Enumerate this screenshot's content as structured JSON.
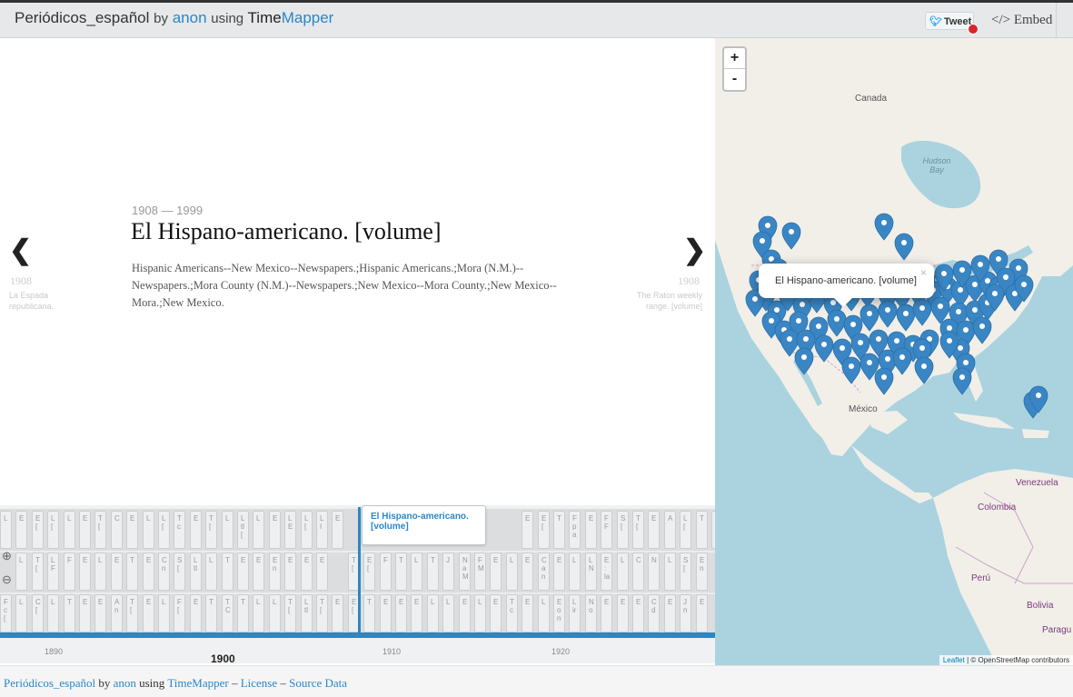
{
  "header": {
    "dataset_title": "Periódicos_español",
    "by_text": "by",
    "author": "anon",
    "using_text": "using",
    "app_name_part1": "Time",
    "app_name_part2": "Mapper",
    "tweet_label": "Tweet",
    "embed_label": "</> Embed"
  },
  "story": {
    "prev_arrow": "❮",
    "next_arrow": "❯",
    "prev": {
      "date": "1908",
      "title": "La Espada republicana."
    },
    "next": {
      "date": "1908",
      "title": "The Raton weekly range. [volume]"
    },
    "current": {
      "date_range": "1908 — 1999",
      "title": "El Hispano-americano. [volume]",
      "description": "Hispanic Americans--New Mexico--Newspapers.;Hispanic Americans.;Mora (N.M.)--Newspapers.;Mora County (N.M.)--Newspapers.;New Mexico--Mora County.;New Mexico--Mora.;New Mexico."
    }
  },
  "timeline": {
    "zoom_in_icon": "⊕",
    "zoom_out_icon": "⊖",
    "active_flag": "El Hispano-americano. [volume]",
    "ticks": [
      {
        "label": "1890",
        "major": false
      },
      {
        "label": "1900",
        "major": true
      },
      {
        "label": "1910",
        "major": false
      },
      {
        "label": "1920",
        "major": false
      }
    ],
    "markers": [
      {
        "r": 0,
        "i": 0,
        "t": "L"
      },
      {
        "r": 0,
        "i": 1,
        "t": "E"
      },
      {
        "r": 0,
        "i": 2,
        "t": "E ["
      },
      {
        "r": 0,
        "i": 3,
        "t": "L ["
      },
      {
        "r": 0,
        "i": 4,
        "t": "L"
      },
      {
        "r": 0,
        "i": 5,
        "t": "E"
      },
      {
        "r": 0,
        "i": 6,
        "t": "T ["
      },
      {
        "r": 0,
        "i": 7,
        "t": "C"
      },
      {
        "r": 0,
        "i": 8,
        "t": "E"
      },
      {
        "r": 0,
        "i": 9,
        "t": "L"
      },
      {
        "r": 0,
        "i": 10,
        "t": "L ["
      },
      {
        "r": 0,
        "i": 11,
        "t": "T c"
      },
      {
        "r": 0,
        "i": 12,
        "t": "E"
      },
      {
        "r": 0,
        "i": 13,
        "t": "T ["
      },
      {
        "r": 0,
        "i": 14,
        "t": "L"
      },
      {
        "r": 0,
        "i": 15,
        "t": "L tl ["
      },
      {
        "r": 0,
        "i": 16,
        "t": "L"
      },
      {
        "r": 0,
        "i": 17,
        "t": "E"
      },
      {
        "r": 0,
        "i": 18,
        "t": "L E"
      },
      {
        "r": 0,
        "i": 19,
        "t": "L ["
      },
      {
        "r": 0,
        "i": 20,
        "t": "L I"
      },
      {
        "r": 0,
        "i": 21,
        "t": "E"
      },
      {
        "r": 0,
        "i": 33,
        "t": "E"
      },
      {
        "r": 0,
        "i": 34,
        "t": "E ["
      },
      {
        "r": 0,
        "i": 35,
        "t": "T"
      },
      {
        "r": 0,
        "i": 36,
        "t": "F p a"
      },
      {
        "r": 0,
        "i": 37,
        "t": "E"
      },
      {
        "r": 0,
        "i": 38,
        "t": "F F"
      },
      {
        "r": 0,
        "i": 39,
        "t": "S ["
      },
      {
        "r": 0,
        "i": 40,
        "t": "T ["
      },
      {
        "r": 0,
        "i": 41,
        "t": "E"
      },
      {
        "r": 0,
        "i": 42,
        "t": "A"
      },
      {
        "r": 0,
        "i": 43,
        "t": "L ["
      },
      {
        "r": 0,
        "i": 44,
        "t": "T"
      },
      {
        "r": 0,
        "i": 45,
        "t": "E"
      },
      {
        "r": 0,
        "i": 46,
        "t": "E"
      },
      {
        "r": 1,
        "i": 1,
        "t": "L"
      },
      {
        "r": 1,
        "i": 2,
        "t": "T ["
      },
      {
        "r": 1,
        "i": 3,
        "t": "L F"
      },
      {
        "r": 1,
        "i": 4,
        "t": "F"
      },
      {
        "r": 1,
        "i": 5,
        "t": "E"
      },
      {
        "r": 1,
        "i": 6,
        "t": "L"
      },
      {
        "r": 1,
        "i": 7,
        "t": "E"
      },
      {
        "r": 1,
        "i": 8,
        "t": "T"
      },
      {
        "r": 1,
        "i": 9,
        "t": "E"
      },
      {
        "r": 1,
        "i": 10,
        "t": "C n"
      },
      {
        "r": 1,
        "i": 11,
        "t": "S ["
      },
      {
        "r": 1,
        "i": 12,
        "t": "L tl"
      },
      {
        "r": 1,
        "i": 13,
        "t": "L"
      },
      {
        "r": 1,
        "i": 14,
        "t": "T"
      },
      {
        "r": 1,
        "i": 15,
        "t": "E"
      },
      {
        "r": 1,
        "i": 16,
        "t": "E"
      },
      {
        "r": 1,
        "i": 17,
        "t": "E n"
      },
      {
        "r": 1,
        "i": 18,
        "t": "E"
      },
      {
        "r": 1,
        "i": 19,
        "t": "E"
      },
      {
        "r": 1,
        "i": 20,
        "t": "E"
      },
      {
        "r": 1,
        "i": 22,
        "t": "T ["
      },
      {
        "r": 1,
        "i": 23,
        "t": "E ["
      },
      {
        "r": 1,
        "i": 24,
        "t": "F"
      },
      {
        "r": 1,
        "i": 25,
        "t": "T"
      },
      {
        "r": 1,
        "i": 26,
        "t": "L"
      },
      {
        "r": 1,
        "i": 27,
        "t": "T"
      },
      {
        "r": 1,
        "i": 28,
        "t": "J"
      },
      {
        "r": 1,
        "i": 29,
        "t": "N a M"
      },
      {
        "r": 1,
        "i": 30,
        "t": "F M"
      },
      {
        "r": 1,
        "i": 31,
        "t": "E"
      },
      {
        "r": 1,
        "i": 32,
        "t": "L"
      },
      {
        "r": 1,
        "i": 33,
        "t": "E"
      },
      {
        "r": 1,
        "i": 34,
        "t": "C a n"
      },
      {
        "r": 1,
        "i": 35,
        "t": "E"
      },
      {
        "r": 1,
        "i": 36,
        "t": "L"
      },
      {
        "r": 1,
        "i": 37,
        "t": "L N"
      },
      {
        "r": 1,
        "i": 38,
        "t": "E : la"
      },
      {
        "r": 1,
        "i": 39,
        "t": "L"
      },
      {
        "r": 1,
        "i": 40,
        "t": "C"
      },
      {
        "r": 1,
        "i": 41,
        "t": "N"
      },
      {
        "r": 1,
        "i": 42,
        "t": "L"
      },
      {
        "r": 1,
        "i": 43,
        "t": "S ["
      },
      {
        "r": 1,
        "i": 44,
        "t": "E n"
      },
      {
        "r": 2,
        "i": 0,
        "t": "F c ["
      },
      {
        "r": 2,
        "i": 1,
        "t": "L"
      },
      {
        "r": 2,
        "i": 2,
        "t": "C ["
      },
      {
        "r": 2,
        "i": 3,
        "t": "L"
      },
      {
        "r": 2,
        "i": 4,
        "t": "T"
      },
      {
        "r": 2,
        "i": 5,
        "t": "E"
      },
      {
        "r": 2,
        "i": 6,
        "t": "E"
      },
      {
        "r": 2,
        "i": 7,
        "t": "A n"
      },
      {
        "r": 2,
        "i": 8,
        "t": "T ["
      },
      {
        "r": 2,
        "i": 9,
        "t": "E"
      },
      {
        "r": 2,
        "i": 10,
        "t": "L"
      },
      {
        "r": 2,
        "i": 11,
        "t": "F ["
      },
      {
        "r": 2,
        "i": 12,
        "t": "E"
      },
      {
        "r": 2,
        "i": 13,
        "t": "T"
      },
      {
        "r": 2,
        "i": 14,
        "t": "T C"
      },
      {
        "r": 2,
        "i": 15,
        "t": "T"
      },
      {
        "r": 2,
        "i": 16,
        "t": "L"
      },
      {
        "r": 2,
        "i": 17,
        "t": "L"
      },
      {
        "r": 2,
        "i": 18,
        "t": "T ["
      },
      {
        "r": 2,
        "i": 19,
        "t": "L tl"
      },
      {
        "r": 2,
        "i": 20,
        "t": "T ["
      },
      {
        "r": 2,
        "i": 21,
        "t": "E"
      },
      {
        "r": 2,
        "i": 22,
        "t": "E ["
      },
      {
        "r": 2,
        "i": 23,
        "t": "T"
      },
      {
        "r": 2,
        "i": 24,
        "t": "E"
      },
      {
        "r": 2,
        "i": 25,
        "t": "E"
      },
      {
        "r": 2,
        "i": 26,
        "t": "E"
      },
      {
        "r": 2,
        "i": 27,
        "t": "L"
      },
      {
        "r": 2,
        "i": 28,
        "t": "L"
      },
      {
        "r": 2,
        "i": 29,
        "t": "E"
      },
      {
        "r": 2,
        "i": 30,
        "t": "L"
      },
      {
        "r": 2,
        "i": 31,
        "t": "E"
      },
      {
        "r": 2,
        "i": 32,
        "t": "T c"
      },
      {
        "r": 2,
        "i": 33,
        "t": "E"
      },
      {
        "r": 2,
        "i": 34,
        "t": "L"
      },
      {
        "r": 2,
        "i": 35,
        "t": "E o n"
      },
      {
        "r": 2,
        "i": 36,
        "t": "L ir"
      },
      {
        "r": 2,
        "i": 37,
        "t": "N o"
      },
      {
        "r": 2,
        "i": 38,
        "t": "E"
      },
      {
        "r": 2,
        "i": 39,
        "t": "E"
      },
      {
        "r": 2,
        "i": 40,
        "t": "E"
      },
      {
        "r": 2,
        "i": 41,
        "t": "C d"
      },
      {
        "r": 2,
        "i": 42,
        "t": "E"
      },
      {
        "r": 2,
        "i": 43,
        "t": "J n"
      },
      {
        "r": 2,
        "i": 44,
        "t": "E"
      }
    ]
  },
  "map": {
    "zoom_in": "+",
    "zoom_out": "-",
    "labels": {
      "canada": "Canada",
      "hudson_bay": "Hudson Bay",
      "mexico": "México",
      "venezuela": "Venezuela",
      "colombia": "Colombia",
      "peru": "Perú",
      "bolivia": "Bolivia",
      "paraguay": "Paragu"
    },
    "popup_text": "El Hispano-americano. [volume]",
    "popup_close": "×",
    "attribution_leaflet": "Leaflet",
    "attribution_rest": "| © OpenStreetMap contributors",
    "pin_color": "#3a86c4"
  },
  "footer": {
    "dataset_title": "Periódicos_español",
    "by_text": "by",
    "author": "anon",
    "using_text": "using",
    "app_name": "TimeMapper",
    "sep1": "–",
    "license": "License",
    "sep2": "–",
    "source_data": "Source Data"
  }
}
